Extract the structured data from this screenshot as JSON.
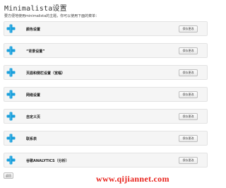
{
  "page": {
    "title": "Minimalista设置",
    "subtitle": "要方便地使用minimalista的主题，你可以使用下面的菜单："
  },
  "sections": [
    {
      "label": "颜色设置",
      "icon": "plus-icon",
      "save_label": "保存更改"
    },
    {
      "label": "“背景设置”",
      "icon": "plus-icon",
      "save_label": "保存更改"
    },
    {
      "label": "页眉和侧栏设置（宽幅）",
      "icon": "plus-icon",
      "save_label": "保存更改"
    },
    {
      "label": "网络设置",
      "icon": "plus-icon",
      "save_label": "保存更改"
    },
    {
      "label": "自定义页",
      "icon": "plus-icon",
      "save_label": "保存更改"
    },
    {
      "label": "联系表",
      "icon": "plus-icon",
      "save_label": "保存更改"
    },
    {
      "label": "谷歌ANALYTICS（分析）",
      "icon": "plus-icon",
      "save_label": "保存更改"
    }
  ],
  "footer": {
    "back_label": "返回"
  },
  "watermark": "www.qijiannet.com",
  "colors": {
    "plus_icon": "#1a9fdb",
    "watermark": "#e8231d"
  }
}
